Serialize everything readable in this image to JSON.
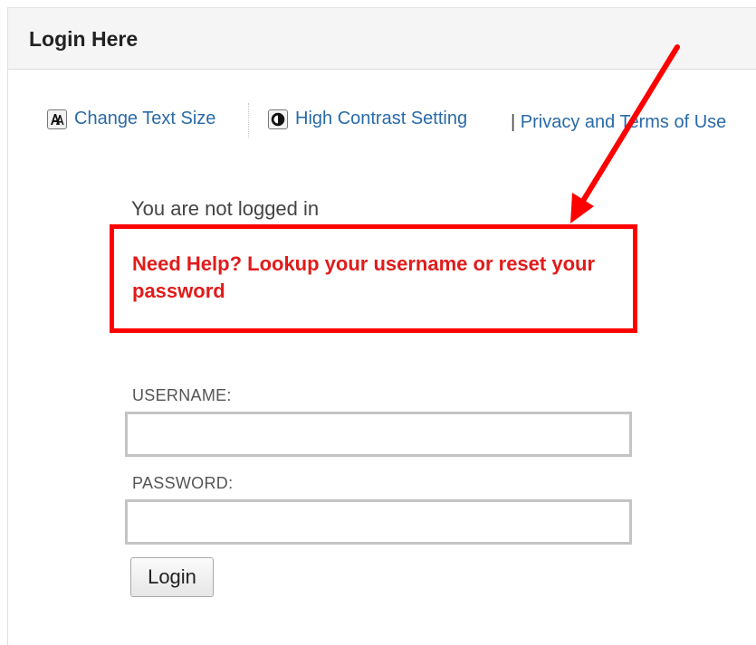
{
  "panel": {
    "title": "Login Here"
  },
  "accessibility": {
    "text_size_label": "Change Text Size",
    "text_size_icon": "text-size-icon",
    "contrast_label": "High Contrast Setting",
    "contrast_icon": "contrast-icon",
    "privacy_separator": "|",
    "privacy_label": "Privacy and Terms of Use"
  },
  "status": {
    "message": "You are not logged in"
  },
  "help": {
    "link_text": "Need Help? Lookup your username or reset your password"
  },
  "form": {
    "username_label": "USERNAME:",
    "username_value": "",
    "password_label": "PASSWORD:",
    "password_value": "",
    "login_button": "Login"
  },
  "annotation": {
    "highlight_color": "#ff0000",
    "link_color": "#2a6aa8"
  }
}
